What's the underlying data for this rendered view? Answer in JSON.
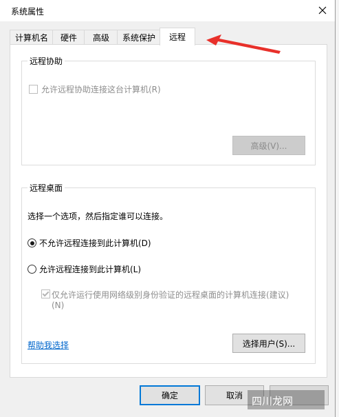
{
  "window": {
    "title": "系统属性",
    "close_icon": "close-icon"
  },
  "tabs": [
    {
      "label": "计算机名"
    },
    {
      "label": "硬件"
    },
    {
      "label": "高级"
    },
    {
      "label": "系统保护"
    },
    {
      "label": "远程",
      "active": true
    }
  ],
  "remote_assistance": {
    "title": "远程协助",
    "checkbox_label": "允许远程协助连接这台计算机(R)",
    "checked": false,
    "advanced_button": "高级(V)..."
  },
  "remote_desktop": {
    "title": "远程桌面",
    "instruction": "选择一个选项，然后指定谁可以连接。",
    "option_deny": "不允许远程连接到此计算机(D)",
    "option_allow": "允许远程连接到此计算机(L)",
    "selected": "deny",
    "nla_label_line1": "仅允许运行使用网络级别身份验证的远程桌面的计算机连接(建议)",
    "nla_label_line2": "(N)",
    "nla_checked": true,
    "help_link": "帮助我选择",
    "select_users_button": "选择用户(S)..."
  },
  "footer": {
    "ok_button": "确定",
    "cancel_button": "取消"
  },
  "watermark": {
    "brand": "四川龙网"
  },
  "colors": {
    "accent": "#0078d7",
    "link": "#0066cc",
    "annotation_arrow": "#e8302a"
  }
}
